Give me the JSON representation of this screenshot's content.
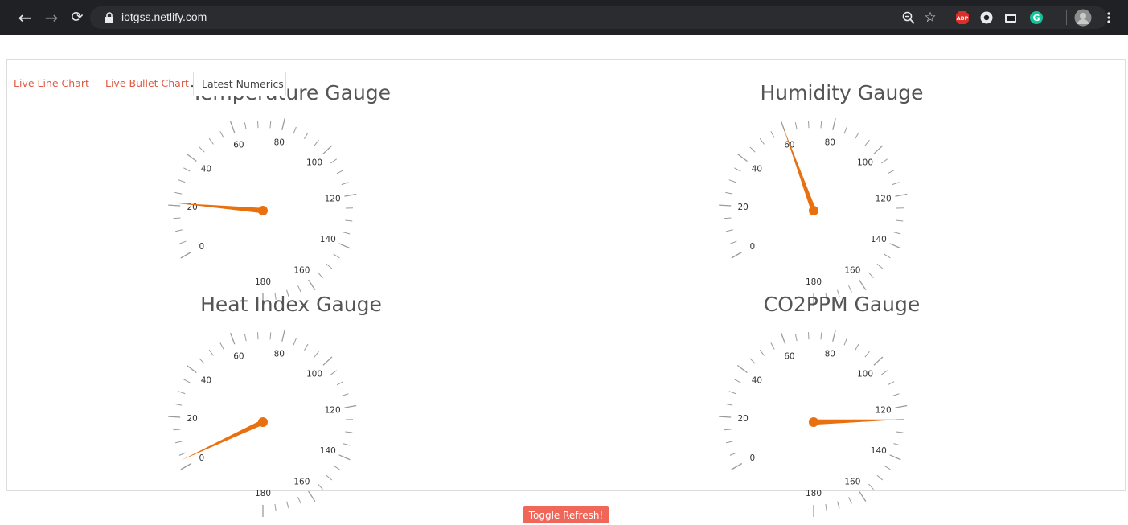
{
  "browser": {
    "url": "iotgss.netlify.com",
    "icons": [
      "back-arrow-icon",
      "forward-arrow-icon",
      "reload-icon",
      "lock-icon",
      "zoom-icon",
      "star-icon",
      "adblock-icon",
      "extension-icon",
      "extension-icon",
      "grammarly-icon",
      "profile-avatar-icon",
      "menu-icon"
    ]
  },
  "tabs": [
    {
      "label": "Live Line Chart",
      "active": false
    },
    {
      "label": "Live Bullet Chart",
      "active": false
    },
    {
      "label": "Latest Numerics",
      "active": true
    }
  ],
  "gauges": [
    {
      "title": "Temperature Gauge",
      "value": 21
    },
    {
      "title": "Humidity Gauge",
      "value": 60
    },
    {
      "title": "Heat Index Gauge",
      "value": 3
    },
    {
      "title": "CO2PPM Gauge",
      "value": 125
    }
  ],
  "gauge_scale": {
    "min": 0,
    "max": 180,
    "major_step": 20,
    "minor_per_major": 4,
    "labels": [
      "0",
      "20",
      "40",
      "60",
      "80",
      "100",
      "120",
      "140",
      "160",
      "180"
    ]
  },
  "colors": {
    "needle": "#e8700f",
    "accent_link": "#e05a44",
    "toggle_bg": "#f0675a"
  },
  "toggle_button": {
    "label": "Toggle Refresh!"
  }
}
